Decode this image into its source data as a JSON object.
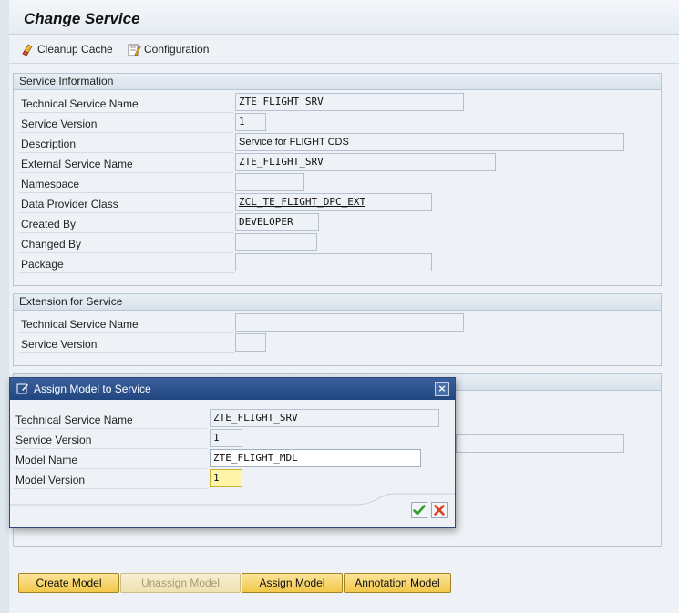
{
  "page": {
    "title": "Change Service"
  },
  "toolbar": {
    "cleanup_cache": "Cleanup Cache",
    "configuration": "Configuration"
  },
  "service_info": {
    "header": "Service Information",
    "fields": [
      {
        "label": "Technical Service Name",
        "value": "ZTE_FLIGHT_SRV"
      },
      {
        "label": "Service Version",
        "value": "1"
      },
      {
        "label": "Description",
        "value": "Service for FLIGHT CDS"
      },
      {
        "label": "External Service Name",
        "value": "ZTE_FLIGHT_SRV"
      },
      {
        "label": "Namespace",
        "value": ""
      },
      {
        "label": "Data Provider Class",
        "value": "ZCL_TE_FLIGHT_DPC_EXT"
      },
      {
        "label": "Created By",
        "value": "DEVELOPER"
      },
      {
        "label": "Changed By",
        "value": ""
      },
      {
        "label": "Package",
        "value": ""
      }
    ]
  },
  "extension": {
    "header": "Extension for Service",
    "fields": [
      {
        "label": "Technical Service Name",
        "value": ""
      },
      {
        "label": "Service Version",
        "value": ""
      }
    ]
  },
  "dialog": {
    "title": "Assign Model to Service",
    "close": "×",
    "fields": [
      {
        "label": "Technical Service Name",
        "value": "ZTE_FLIGHT_SRV"
      },
      {
        "label": "Service Version",
        "value": "1"
      },
      {
        "label": "Model Name",
        "value": "ZTE_FLIGHT_MDL"
      },
      {
        "label": "Model Version",
        "value": "1"
      }
    ]
  },
  "buttons": {
    "create_model": "Create Model",
    "unassign_model": "Unassign Model",
    "assign_model": "Assign Model",
    "annotation_model": "Annotation Model"
  },
  "colors": {
    "accent": "#22467f",
    "button": "#f3c84a",
    "required": "#fff4a8"
  }
}
